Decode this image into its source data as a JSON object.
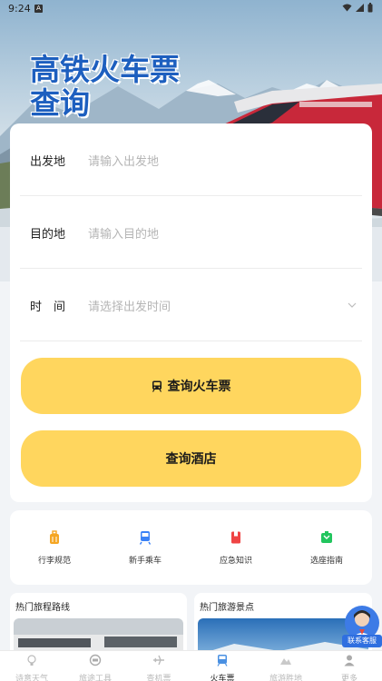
{
  "status_bar": {
    "time": "9:24",
    "badge": "A"
  },
  "hero": {
    "title_line1": "高铁火车票",
    "title_line2": "查询"
  },
  "form": {
    "origin": {
      "label": "出发地",
      "placeholder": "请输入出发地"
    },
    "destination": {
      "label": "目的地",
      "placeholder": "请输入目的地"
    },
    "date": {
      "label": "时　间",
      "placeholder": "请选择出发时间"
    },
    "search_train_label": "查询火车票",
    "search_hotel_label": "查询酒店"
  },
  "quick_links": [
    {
      "label": "行李规范",
      "icon": "luggage-icon",
      "color": "#f5a623"
    },
    {
      "label": "新手乘车",
      "icon": "train-icon",
      "color": "#3b82f6"
    },
    {
      "label": "应急知识",
      "icon": "book-icon",
      "color": "#ef4444"
    },
    {
      "label": "选座指南",
      "icon": "seat-icon",
      "color": "#22c55e"
    }
  ],
  "sections": {
    "hot_routes": "热门旅程路线",
    "hot_spots": "热门旅游景点"
  },
  "customer_service": {
    "label": "联系客服"
  },
  "tabs": [
    {
      "label": "诗意天气",
      "icon": "bulb-icon"
    },
    {
      "label": "旅途工具",
      "icon": "tools-icon"
    },
    {
      "label": "查机票",
      "icon": "plane-icon"
    },
    {
      "label": "火车票",
      "icon": "train-icon",
      "active": true
    },
    {
      "label": "旅游胜地",
      "icon": "mountain-icon"
    },
    {
      "label": "更多",
      "icon": "person-icon"
    }
  ],
  "colors": {
    "accent": "#ffd65e",
    "title_blue": "#1d5fbf",
    "service_blue": "#2f6fe0"
  }
}
